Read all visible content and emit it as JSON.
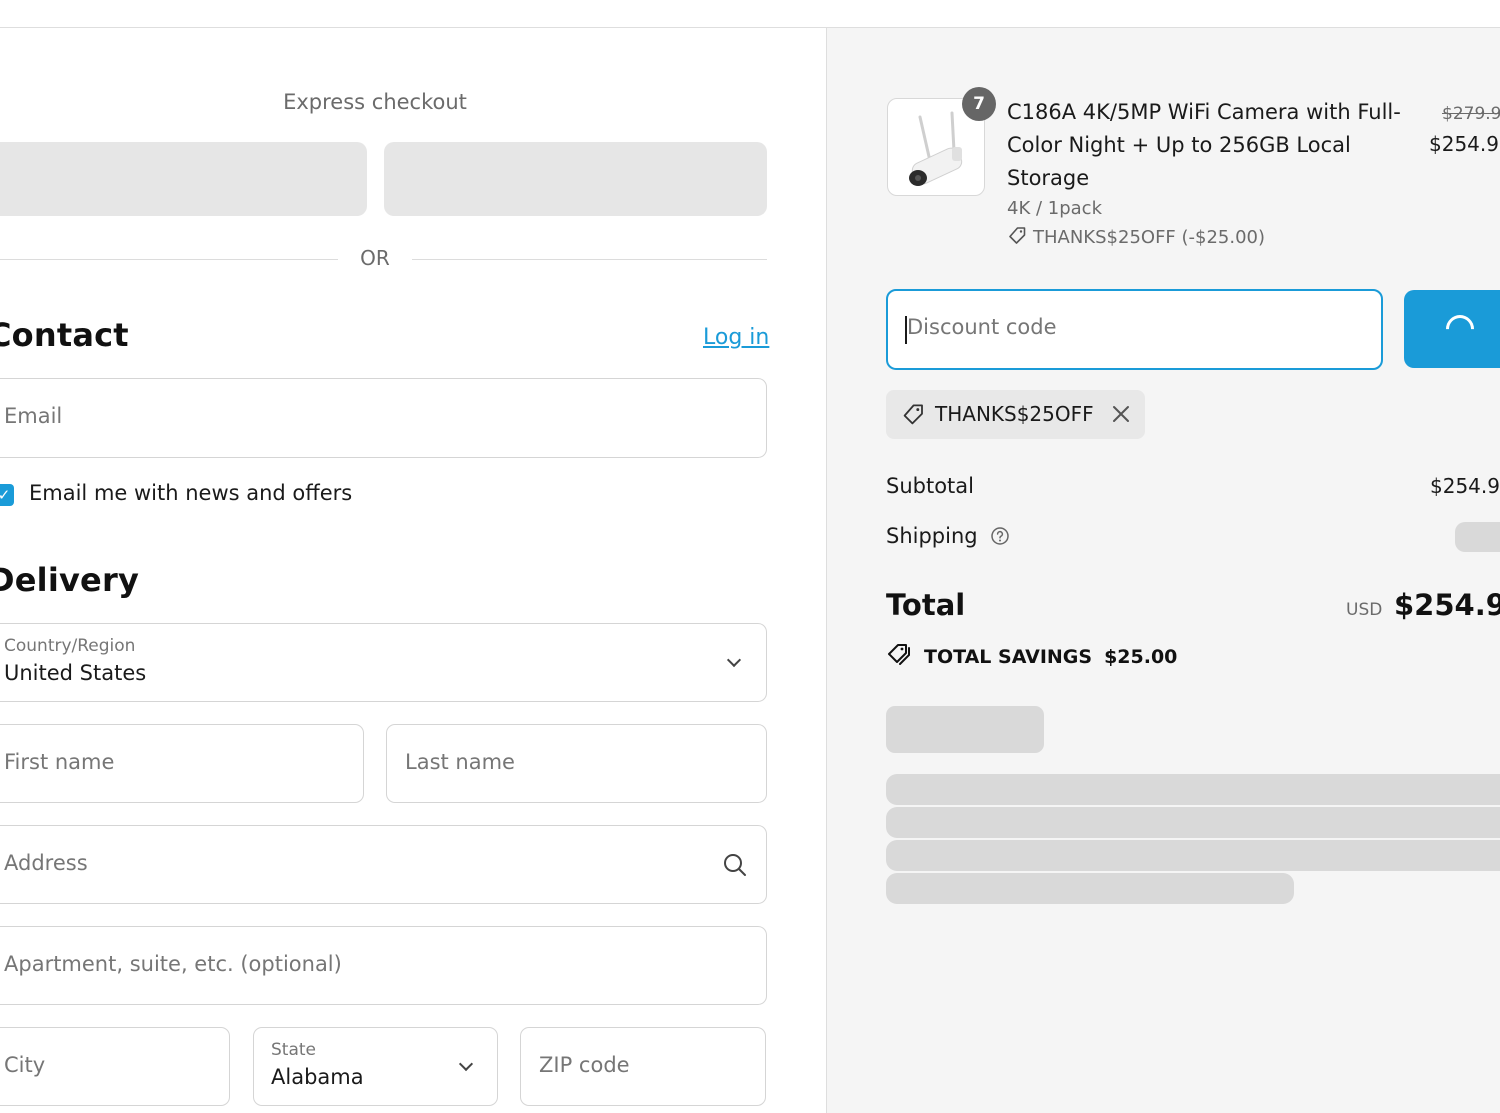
{
  "express": {
    "title": "Express checkout",
    "or": "OR"
  },
  "contact": {
    "heading": "Contact",
    "login": "Log in",
    "email_placeholder": "Email",
    "newsletter_label": "Email me with news and offers",
    "newsletter_checked": true
  },
  "delivery": {
    "heading": "Delivery",
    "country_label": "Country/Region",
    "country_value": "United States",
    "first_name_placeholder": "First name",
    "last_name_placeholder": "Last name",
    "address_placeholder": "Address",
    "apartment_placeholder": "Apartment, suite, etc. (optional)",
    "city_placeholder": "City",
    "state_label": "State",
    "state_value": "Alabama",
    "zip_placeholder": "ZIP code"
  },
  "order": {
    "item": {
      "quantity": "7",
      "title": "C186A 4K/5MP WiFi Camera with Full-Color Night + Up to 256GB Local Storage",
      "variant": "4K / 1pack",
      "discount": "THANKS$25OFF (-$25.00)",
      "price_original": "$279.9",
      "price": "$254.9"
    },
    "discount_placeholder": "Discount code",
    "applied_code": "THANKS$25OFF",
    "subtotal_label": "Subtotal",
    "subtotal_value": "$254.9",
    "shipping_label": "Shipping",
    "total_label": "Total",
    "currency": "USD",
    "total_value": "$254.9",
    "savings_label": "TOTAL SAVINGS",
    "savings_value": "$25.00"
  },
  "colors": {
    "accent": "#1a9bd8",
    "panel": "#f5f5f5",
    "skeleton": "#d9d9d9"
  }
}
